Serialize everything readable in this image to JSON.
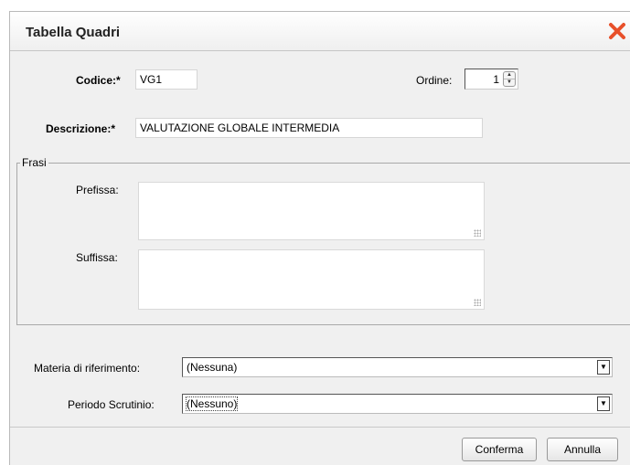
{
  "dialog": {
    "title": "Tabella Quadri",
    "close_icon": "close-x-icon",
    "accent_close": "#e8502a"
  },
  "codice": {
    "label": "Codice:*",
    "value": "VG1"
  },
  "ordine": {
    "label": "Ordine:",
    "value": "1"
  },
  "descrizione": {
    "label": "Descrizione:*",
    "value": "VALUTAZIONE GLOBALE INTERMEDIA"
  },
  "frasi": {
    "legend": "Frasi",
    "prefissa_label": "Prefissa:",
    "prefissa_value": "",
    "suffissa_label": "Suffissa:",
    "suffissa_value": ""
  },
  "materia": {
    "label": "Materia di riferimento:",
    "selected": "(Nessuna)"
  },
  "periodo": {
    "label": "Periodo Scrutinio:",
    "selected": "(Nessuno)"
  },
  "buttons": {
    "confirm": "Conferma",
    "cancel": "Annulla"
  }
}
